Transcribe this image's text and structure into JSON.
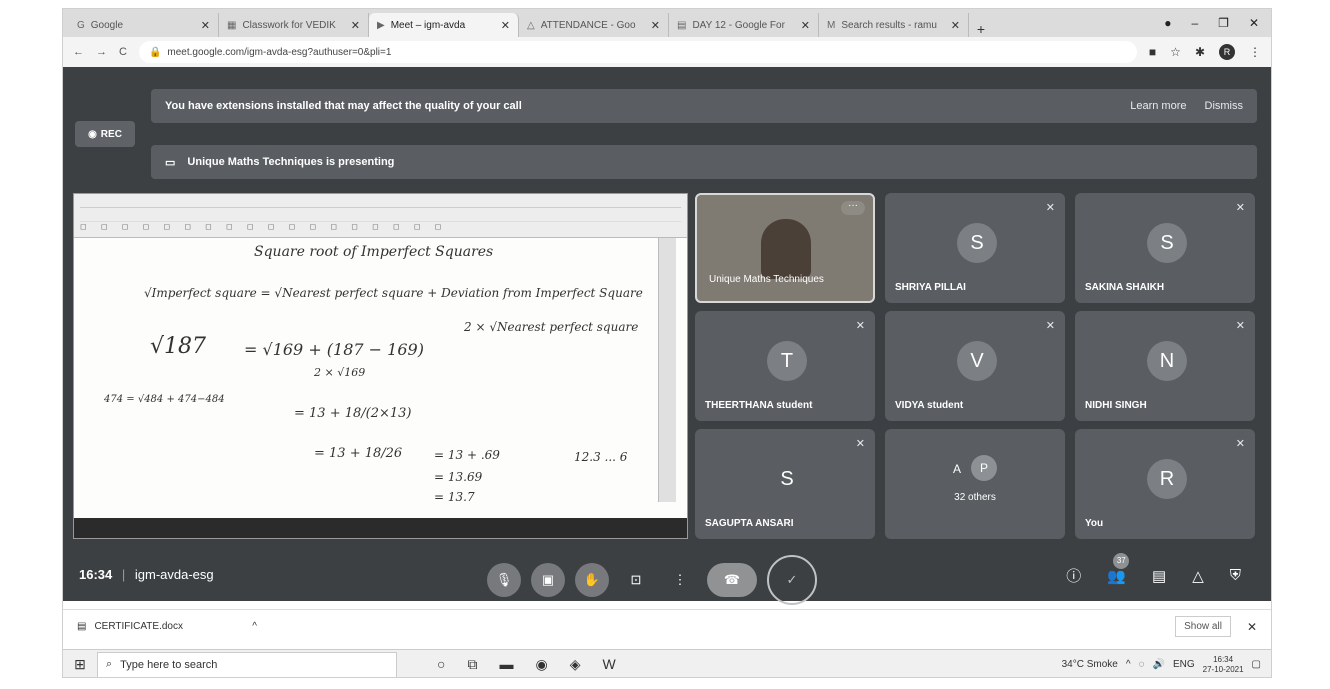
{
  "browser": {
    "tabs": [
      {
        "label": "Google",
        "icon": "G",
        "active": false
      },
      {
        "label": "Classwork for VEDIK",
        "icon": "▦",
        "active": false
      },
      {
        "label": "Meet – igm-avda",
        "icon": "▶",
        "active": true
      },
      {
        "label": "ATTENDANCE - Goo",
        "icon": "△",
        "active": false
      },
      {
        "label": "DAY 12 - Google For",
        "icon": "▤",
        "active": false
      },
      {
        "label": "Search results - ramu",
        "icon": "M",
        "active": false
      }
    ],
    "url": "meet.google.com/igm-avda-esg?authuser=0&pli=1",
    "profile_initial": "R"
  },
  "meet": {
    "rec_label": "REC",
    "extension_banner": "You have extensions installed that may affect the quality of your call",
    "learn_more": "Learn more",
    "dismiss": "Dismiss",
    "presenting_banner": "Unique Maths Techniques is presenting",
    "participants": [
      {
        "name": "Unique Maths Techniques",
        "initial": "",
        "video": true
      },
      {
        "name": "SHRIYA PILLAI",
        "initial": "S"
      },
      {
        "name": "SAKINA SHAIKH",
        "initial": "S"
      },
      {
        "name": "THEERTHANA student",
        "initial": "T"
      },
      {
        "name": "VIDYA student",
        "initial": "V"
      },
      {
        "name": "NIDHI SINGH",
        "initial": "N"
      },
      {
        "name": "SAGUPTA ANSARI",
        "initial": "S"
      },
      {
        "name": "32 others",
        "initial": "A",
        "initial2": "P"
      },
      {
        "name": "You",
        "initial": "R"
      }
    ],
    "time": "16:34",
    "meeting_code": "igm-avda-esg",
    "people_count": "37"
  },
  "presentation": {
    "title": "Square root of Imperfect Squares",
    "formula": "√Imperfect square = √Nearest perfect square + Deviation from Imperfect Square",
    "denominator": "2 × √Nearest perfect square",
    "example_lhs": "√187",
    "example_rhs": "= √169 + (187 − 169)",
    "example_den": "2 × √169",
    "step1": "= 13 + 18/(2×13)",
    "step2": "= 13 + 18/26",
    "step3": "= 13 + .69",
    "step4": "= 13.69",
    "step5": "= 13.7",
    "side_work": "474 = √484 + 474−484",
    "ans": "12.3 ... 6"
  },
  "downloads": {
    "file": "CERTIFICATE.docx",
    "show_all": "Show all"
  },
  "taskbar": {
    "search_placeholder": "Type here to search",
    "weather": "34°C  Smoke",
    "lang": "ENG",
    "time": "16:34",
    "date": "27-10-2021"
  }
}
